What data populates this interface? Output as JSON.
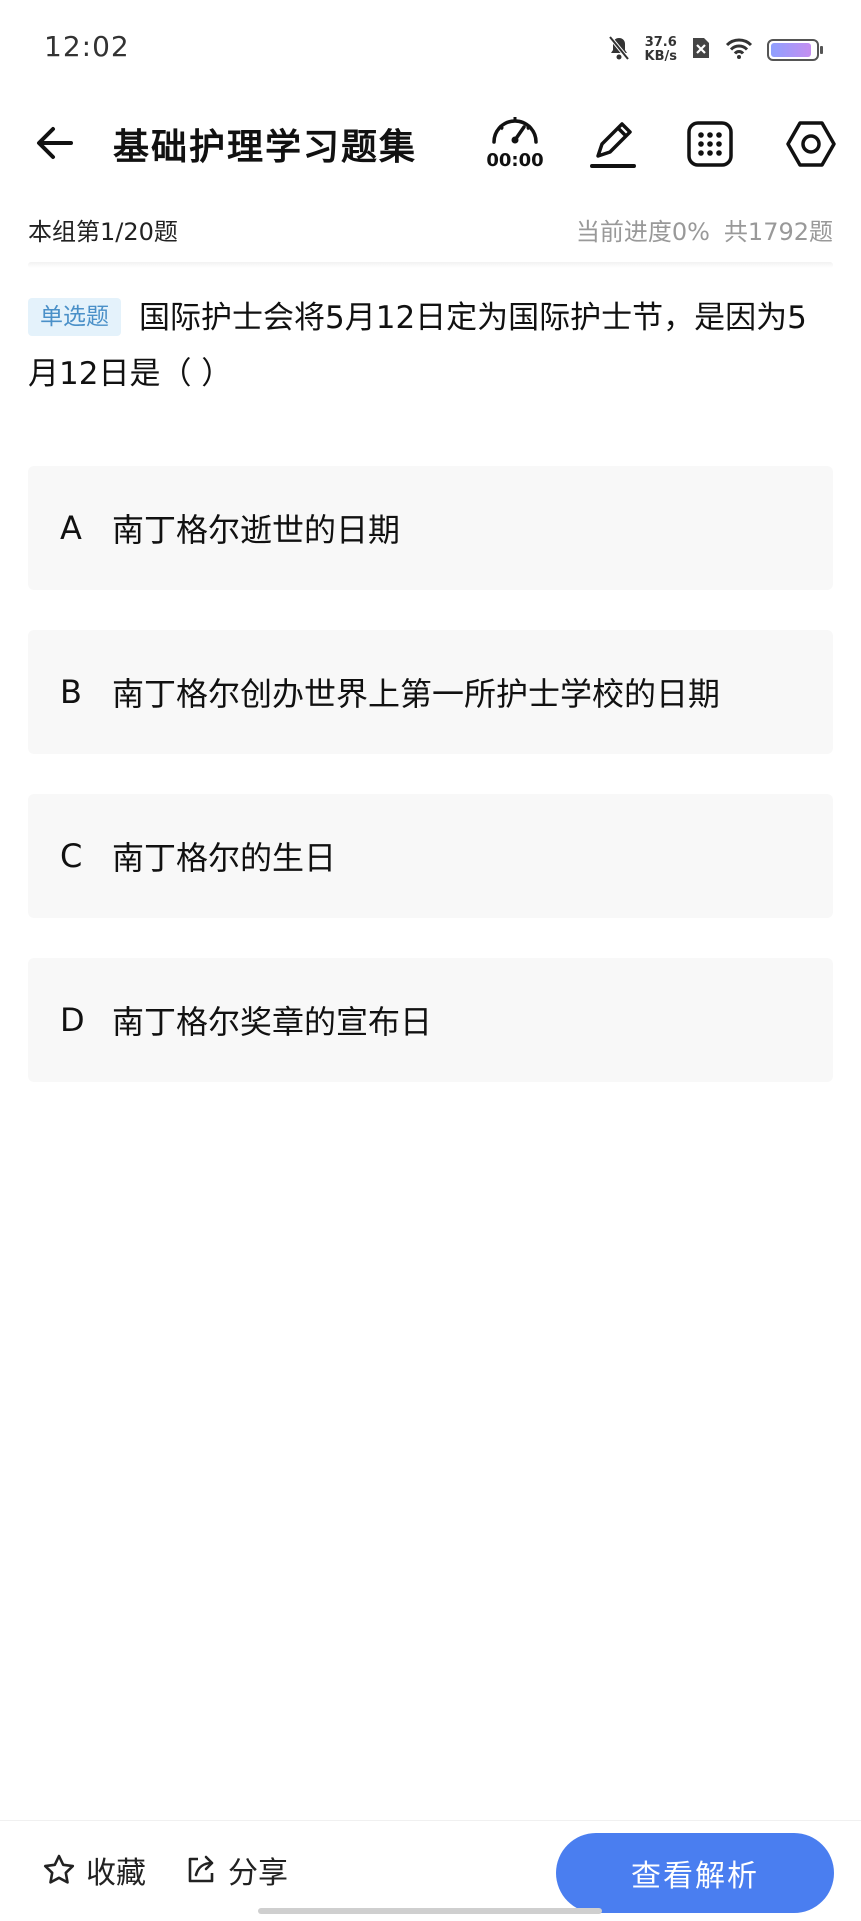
{
  "status_bar": {
    "time": "12:02",
    "net_speed_value": "37.6",
    "net_speed_unit": "KB/s"
  },
  "header": {
    "title": "基础护理学习题集",
    "timer": "00:00"
  },
  "progress": {
    "group": "本组第1/20题",
    "current": "当前进度0%",
    "total": "共1792题"
  },
  "question": {
    "type_label": "单选题",
    "text": "国际护士会将5月12日定为国际护士节，是因为5月12日是（    ）"
  },
  "options": [
    {
      "letter": "A",
      "text": "南丁格尔逝世的日期"
    },
    {
      "letter": "B",
      "text": "南丁格尔创办世界上第一所护士学校的日期"
    },
    {
      "letter": "C",
      "text": "南丁格尔的生日"
    },
    {
      "letter": "D",
      "text": "南丁格尔奖章的宣布日"
    }
  ],
  "bottom_bar": {
    "favorite_label": "收藏",
    "share_label": "分享",
    "analysis_label": "查看解析"
  },
  "colors": {
    "accent": "#4a7ef0",
    "tag_bg": "#e4f2fb",
    "tag_text": "#4a90c8",
    "option_bg": "#f8f8f8"
  }
}
